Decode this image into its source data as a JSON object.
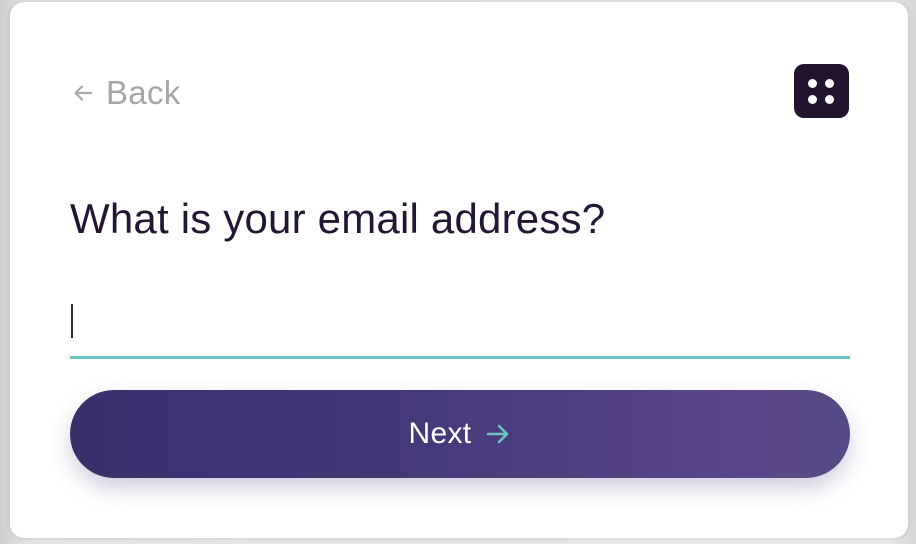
{
  "back": {
    "label": "Back",
    "icon": "arrow-left-icon"
  },
  "menu": {
    "icon": "four-dots-icon",
    "color": "#22132f"
  },
  "question": {
    "text": "What is your email address?"
  },
  "email": {
    "value": "",
    "placeholder": "",
    "underline_color": "#6cc3c3"
  },
  "next_button": {
    "label": "Next",
    "icon": "arrow-right-icon",
    "arrow_color": "#6cc3c3",
    "gradient_start": "#3a2f6b",
    "gradient_end": "#5a4686"
  }
}
